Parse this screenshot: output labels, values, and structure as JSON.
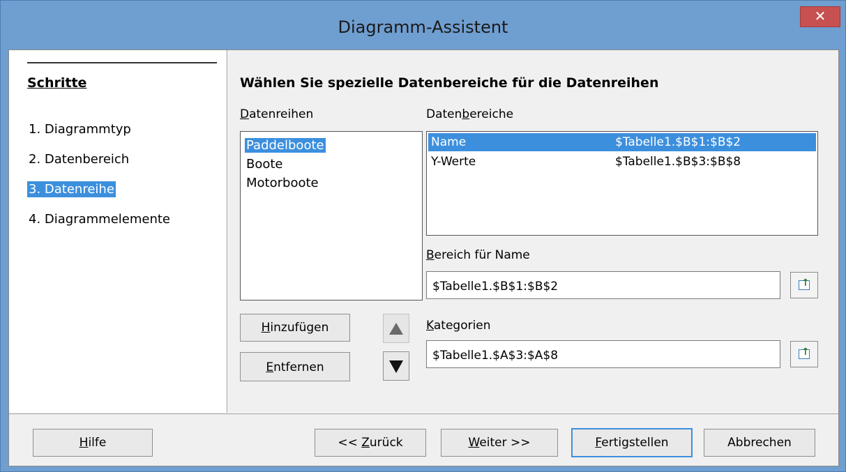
{
  "window": {
    "title": "Diagramm-Assistent",
    "close_symbol": "✕"
  },
  "steps": {
    "title": "Schritte",
    "items": [
      {
        "label": "1. Diagrammtyp"
      },
      {
        "label": "2. Datenbereich"
      },
      {
        "label": "3. Datenreihe",
        "active": true
      },
      {
        "label": "4. Diagrammelemente"
      }
    ]
  },
  "main": {
    "heading": "Wählen Sie spezielle Datenbereiche für die Datenreihen",
    "series": {
      "label_pre": "",
      "label_u": "D",
      "label_post": "atenreihen",
      "items": [
        "Paddelboote",
        "Boote",
        "Motorboote"
      ],
      "selected": "Paddelboote"
    },
    "ranges": {
      "label_pre": "Daten",
      "label_u": "b",
      "label_post": "ereiche",
      "rows": [
        {
          "name": "Name",
          "range": "$Tabelle1.$B$1:$B$2",
          "selected": true
        },
        {
          "name": "Y-Werte",
          "range": "$Tabelle1.$B$3:$B$8",
          "selected": false
        }
      ]
    },
    "name_range": {
      "label_pre": "",
      "label_u": "B",
      "label_post": "ereich für Name",
      "value": "$Tabelle1.$B$1:$B$2"
    },
    "categories": {
      "label_pre": "",
      "label_u": "K",
      "label_post": "ategorien",
      "value": "$Tabelle1.$A$3:$A$8"
    },
    "add_button": {
      "pre": "",
      "u": "H",
      "post": "inzufügen"
    },
    "remove_button": {
      "pre": "",
      "u": "E",
      "post": "ntfernen"
    },
    "up_icon": "triangle-up-icon",
    "down_icon": "triangle-down-icon"
  },
  "footer": {
    "help": {
      "pre": "",
      "u": "H",
      "post": "ilfe"
    },
    "back": {
      "pre": "<< ",
      "u": "Z",
      "post": "urück"
    },
    "next": {
      "pre": "",
      "u": "W",
      "post": "eiter >>"
    },
    "finish": {
      "pre": "",
      "u": "F",
      "post": "ertigstellen"
    },
    "cancel": {
      "label": "Abbrechen"
    }
  },
  "colors": {
    "titlebar": "#6f9ed0",
    "selection": "#3c8fdd",
    "close": "#c75050"
  }
}
